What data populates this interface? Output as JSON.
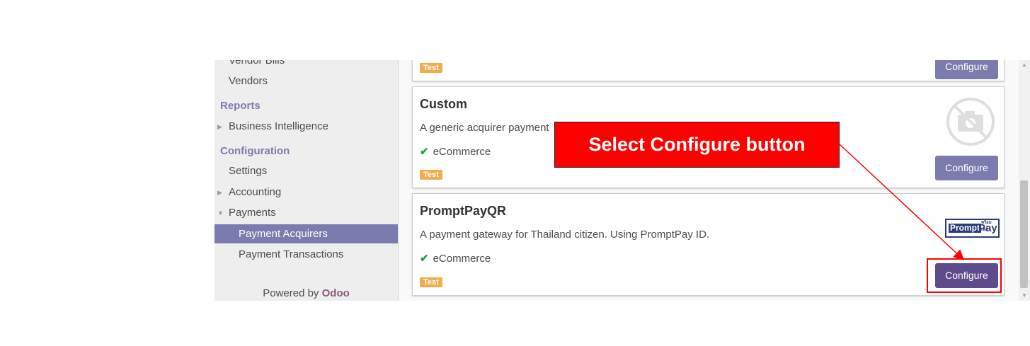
{
  "sidebar": {
    "items_top": [
      "Vendor Bills",
      "Vendors"
    ],
    "reports_heading": "Reports",
    "business_intelligence": "Business Intelligence",
    "config_heading": "Configuration",
    "settings": "Settings",
    "accounting": "Accounting",
    "payments": "Payments",
    "payment_acquirers": "Payment Acquirers",
    "payment_transactions": "Payment Transactions",
    "powered_by": "Powered by",
    "brand": "Odoo"
  },
  "cards": [
    {
      "tag": "Test",
      "button": "Configure"
    },
    {
      "title": "Custom",
      "description": "A generic acquirer payment",
      "feature": "eCommerce",
      "tag": "Test",
      "button": "Configure",
      "image_icon": "no-image-camera-icon"
    },
    {
      "title": "PromptPayQR",
      "description": "A payment gateway for Thailand citizen. Using PromptPay ID.",
      "feature": "eCommerce",
      "tag": "Test",
      "button": "Configure",
      "logo": {
        "part1": "Prompt",
        "part2": "Pay",
        "small": "พร้อมเพย์"
      }
    }
  ],
  "annotation": {
    "callout_text": "Select Configure button"
  },
  "colors": {
    "accent": "#7c7bad",
    "callout": "#ff0000",
    "tag": "#f0ad4e",
    "check": "#21a13a"
  }
}
